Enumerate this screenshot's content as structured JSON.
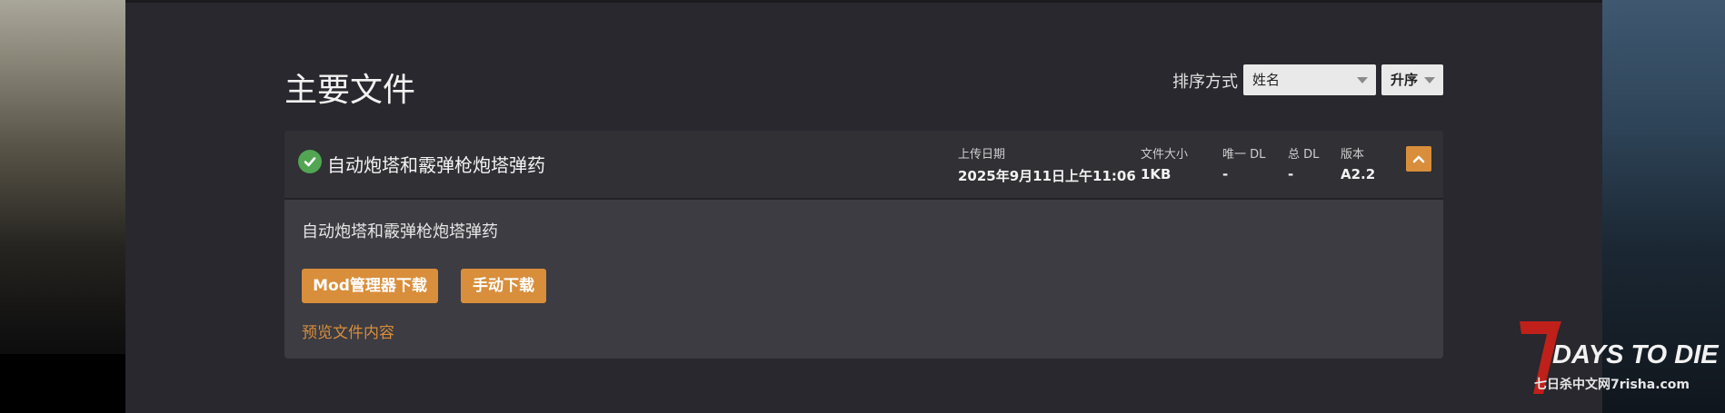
{
  "section": {
    "title": "主要文件"
  },
  "sort": {
    "label": "排序方式",
    "field_value": "姓名",
    "order_value": "升序"
  },
  "file": {
    "name": "自动炮塔和霰弹枪炮塔弹药",
    "status_icon": "check-circle-icon",
    "stats": {
      "upload_date_label": "上传日期",
      "upload_date_value": "2025年9月11日上午11:06",
      "size_label": "文件大小",
      "size_value": "1KB",
      "unique_dl_label": "唯一 DL",
      "unique_dl_value": "-",
      "total_dl_label": "总 DL",
      "total_dl_value": "-",
      "version_label": "版本",
      "version_value": "A2.2"
    },
    "description": "自动炮塔和霰弹枪炮塔弹药",
    "mod_manager_button": "Mod管理器下载",
    "manual_button": "手动下载",
    "preview_link": "预览文件内容"
  },
  "watermark": {
    "logo_text": "7DAYS TO DIE",
    "site_text": "七日杀中文网7risha.com"
  },
  "colors": {
    "accent": "#d98e3b",
    "success": "#52a552",
    "panel": "#3c3c42",
    "background": "#28282e"
  }
}
